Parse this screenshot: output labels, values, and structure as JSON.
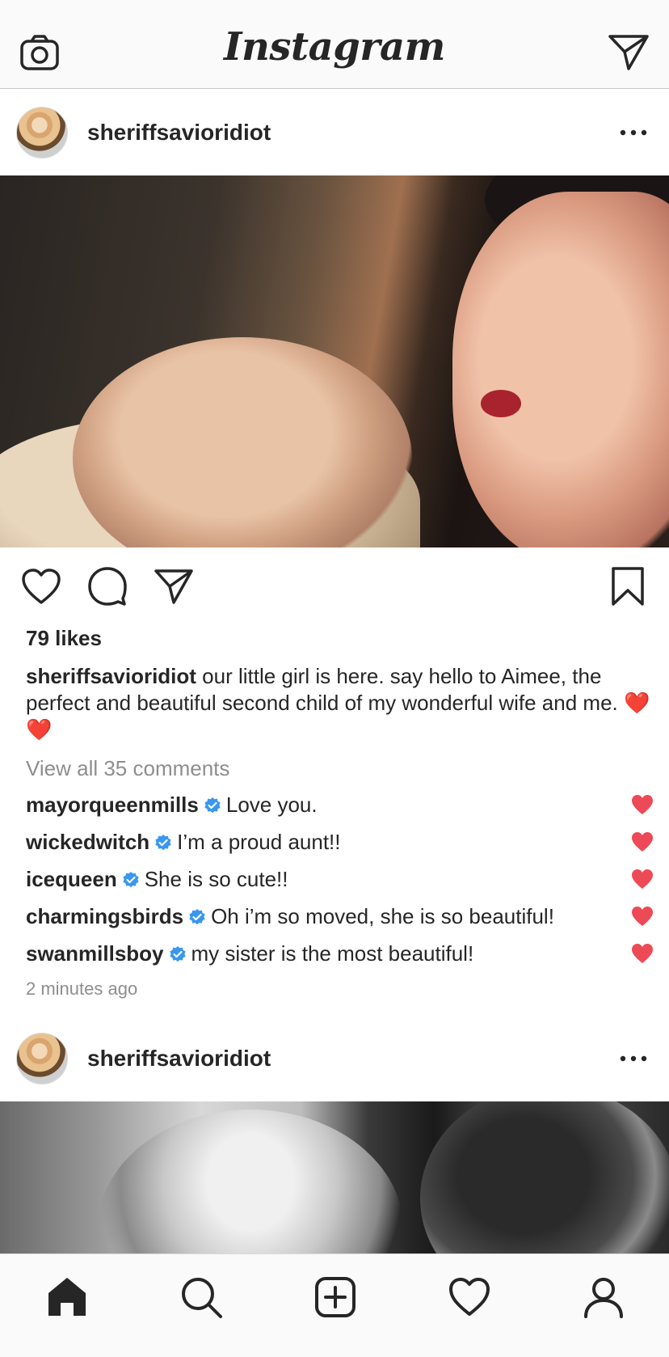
{
  "app": {
    "title": "Instagram",
    "icons": {
      "camera": "camera-icon",
      "direct": "paper-plane-icon"
    }
  },
  "posts": [
    {
      "username": "sheriffsavioridiot",
      "likes": "79 likes",
      "caption_user": "sheriffsavioridiot",
      "caption_text": " our little girl is here. say hello to Aimee, the perfect and beautiful second child of my wonderful wife and me. ❤️❤️",
      "view_all": "View all 35 comments",
      "comments": [
        {
          "user": "mayorqueenmills",
          "text": "Love you."
        },
        {
          "user": "wickedwitch",
          "text": "I’m a proud aunt!!"
        },
        {
          "user": "icequeen",
          "text": "She is so cute!!"
        },
        {
          "user": "charmingsbirds",
          "text": "Oh i’m so moved, she is so beautiful!"
        },
        {
          "user": "swanmillsboy",
          "text": "my sister is the most beautiful!"
        }
      ],
      "timestamp": "2 minutes ago"
    },
    {
      "username": "sheriffsavioridiot"
    }
  ],
  "tabs": [
    "home-icon",
    "search-icon",
    "new-post-icon",
    "activity-heart-icon",
    "profile-icon"
  ],
  "colors": {
    "liked": "#ed4956",
    "verified": "#3897f0",
    "muted": "#8e8e8e",
    "text": "#262626"
  }
}
